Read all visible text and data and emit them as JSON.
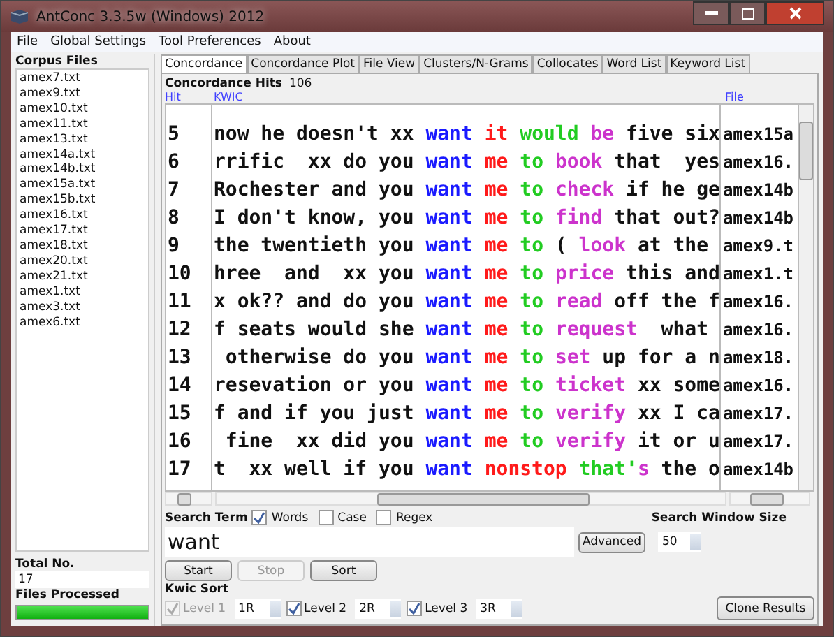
{
  "window": {
    "title": "AntConc 3.3.5w (Windows) 2012"
  },
  "menu": [
    "File",
    "Global Settings",
    "Tool Preferences",
    "About"
  ],
  "corpus": {
    "label": "Corpus Files",
    "files": [
      "amex7.txt",
      "amex9.txt",
      "amex10.txt",
      "amex11.txt",
      "amex13.txt",
      "amex14a.txt",
      "amex14b.txt",
      "amex15a.txt",
      "amex15b.txt",
      "amex16.txt",
      "amex17.txt",
      "amex18.txt",
      "amex20.txt",
      "amex21.txt",
      "amex1.txt",
      "amex3.txt",
      "amex6.txt"
    ],
    "total_label": "Total No.",
    "total": "17",
    "processed_label": "Files Processed",
    "level": 1
  },
  "tabs": [
    {
      "label": "Concordance",
      "selected": true
    },
    {
      "label": "Concordance Plot",
      "selected": false
    },
    {
      "label": "File View",
      "selected": false
    },
    {
      "label": "Clusters/N-Grams",
      "selected": false
    },
    {
      "label": "Collocates",
      "selected": false
    },
    {
      "label": "Word List",
      "selected": false
    },
    {
      "label": "Keyword List",
      "selected": false
    }
  ],
  "hits_label": "Concordance Hits",
  "hits": "106",
  "columns": [
    "Hit",
    "KWIC",
    "File"
  ],
  "rows": [
    {
      "hit": "5",
      "file": "amex15a",
      "segments": [
        {
          "text": "now he doesn't xx ",
          "kind": "plain"
        },
        {
          "text": "want ",
          "kind": "node"
        },
        {
          "text": "it ",
          "kind": "r1"
        },
        {
          "text": "would ",
          "kind": "r2"
        },
        {
          "text": "be",
          "kind": "r3"
        },
        {
          "text": " five six",
          "kind": "plain"
        }
      ]
    },
    {
      "hit": "6",
      "file": "amex16.",
      "segments": [
        {
          "text": "rrific  xx do you ",
          "kind": "plain"
        },
        {
          "text": "want ",
          "kind": "node"
        },
        {
          "text": "me ",
          "kind": "r1"
        },
        {
          "text": "to ",
          "kind": "r2"
        },
        {
          "text": "book",
          "kind": "r3"
        },
        {
          "text": " that  yes",
          "kind": "plain"
        }
      ]
    },
    {
      "hit": "7",
      "file": "amex14b",
      "segments": [
        {
          "text": "Rochester and you ",
          "kind": "plain"
        },
        {
          "text": "want ",
          "kind": "node"
        },
        {
          "text": "me ",
          "kind": "r1"
        },
        {
          "text": "to ",
          "kind": "r2"
        },
        {
          "text": "check",
          "kind": "r3"
        },
        {
          "text": " if he ge",
          "kind": "plain"
        }
      ]
    },
    {
      "hit": "8",
      "file": "amex14b",
      "segments": [
        {
          "text": "I don't know, you ",
          "kind": "plain"
        },
        {
          "text": "want ",
          "kind": "node"
        },
        {
          "text": "me ",
          "kind": "r1"
        },
        {
          "text": "to ",
          "kind": "r2"
        },
        {
          "text": "find",
          "kind": "r3"
        },
        {
          "text": " that out?",
          "kind": "plain"
        }
      ]
    },
    {
      "hit": "9",
      "file": "amex9.t",
      "segments": [
        {
          "text": "the twentieth you ",
          "kind": "plain"
        },
        {
          "text": "want ",
          "kind": "node"
        },
        {
          "text": "me ",
          "kind": "r1"
        },
        {
          "text": "to",
          "kind": "r2"
        },
        {
          "text": " ( ",
          "kind": "plain"
        },
        {
          "text": "look",
          "kind": "r3"
        },
        {
          "text": " at the",
          "kind": "plain"
        }
      ]
    },
    {
      "hit": "10",
      "file": "amex1.t",
      "segments": [
        {
          "text": "hree  and  xx you ",
          "kind": "plain"
        },
        {
          "text": "want ",
          "kind": "node"
        },
        {
          "text": "me ",
          "kind": "r1"
        },
        {
          "text": "to ",
          "kind": "r2"
        },
        {
          "text": "price",
          "kind": "r3"
        },
        {
          "text": " this and",
          "kind": "plain"
        }
      ]
    },
    {
      "hit": "11",
      "file": "amex16.",
      "segments": [
        {
          "text": "x ok?? and do you ",
          "kind": "plain"
        },
        {
          "text": "want ",
          "kind": "node"
        },
        {
          "text": "me ",
          "kind": "r1"
        },
        {
          "text": "to ",
          "kind": "r2"
        },
        {
          "text": "read",
          "kind": "r3"
        },
        {
          "text": " off the f",
          "kind": "plain"
        }
      ]
    },
    {
      "hit": "12",
      "file": "amex16.",
      "segments": [
        {
          "text": "f seats would she ",
          "kind": "plain"
        },
        {
          "text": "want ",
          "kind": "node"
        },
        {
          "text": "me ",
          "kind": "r1"
        },
        {
          "text": "to ",
          "kind": "r2"
        },
        {
          "text": "request",
          "kind": "r3"
        },
        {
          "text": "  what",
          "kind": "plain"
        }
      ]
    },
    {
      "hit": "13",
      "file": "amex18.",
      "segments": [
        {
          "text": " otherwise do you ",
          "kind": "plain"
        },
        {
          "text": "want ",
          "kind": "node"
        },
        {
          "text": "me ",
          "kind": "r1"
        },
        {
          "text": "to ",
          "kind": "r2"
        },
        {
          "text": "set",
          "kind": "r3"
        },
        {
          "text": " up for a n",
          "kind": "plain"
        }
      ]
    },
    {
      "hit": "14",
      "file": "amex16.",
      "segments": [
        {
          "text": "resevation or you ",
          "kind": "plain"
        },
        {
          "text": "want ",
          "kind": "node"
        },
        {
          "text": "me ",
          "kind": "r1"
        },
        {
          "text": "to ",
          "kind": "r2"
        },
        {
          "text": "ticket",
          "kind": "r3"
        },
        {
          "text": " xx some",
          "kind": "plain"
        }
      ]
    },
    {
      "hit": "15",
      "file": "amex17.",
      "segments": [
        {
          "text": "f and if you just ",
          "kind": "plain"
        },
        {
          "text": "want ",
          "kind": "node"
        },
        {
          "text": "me ",
          "kind": "r1"
        },
        {
          "text": "to ",
          "kind": "r2"
        },
        {
          "text": "verify",
          "kind": "r3"
        },
        {
          "text": " xx I ca",
          "kind": "plain"
        }
      ]
    },
    {
      "hit": "16",
      "file": "amex17.",
      "segments": [
        {
          "text": " fine  xx did you ",
          "kind": "plain"
        },
        {
          "text": "want ",
          "kind": "node"
        },
        {
          "text": "me ",
          "kind": "r1"
        },
        {
          "text": "to ",
          "kind": "r2"
        },
        {
          "text": "verify",
          "kind": "r3"
        },
        {
          "text": " it or u",
          "kind": "plain"
        }
      ]
    },
    {
      "hit": "17",
      "file": "amex14b",
      "segments": [
        {
          "text": "t  xx well if you ",
          "kind": "plain"
        },
        {
          "text": "want ",
          "kind": "node"
        },
        {
          "text": "nonstop ",
          "kind": "r1"
        },
        {
          "text": "that'",
          "kind": "r2"
        },
        {
          "text": "s",
          "kind": "r3"
        },
        {
          "text": " the o",
          "kind": "plain"
        }
      ]
    }
  ],
  "search": {
    "label": "Search Term",
    "options": [
      {
        "label": "Words",
        "checked": true
      },
      {
        "label": "Case",
        "checked": false
      },
      {
        "label": "Regex",
        "checked": false
      }
    ],
    "value": "want",
    "advanced": "Advanced",
    "window_label": "Search Window Size",
    "window_size": "50"
  },
  "buttons": [
    {
      "label": "Start",
      "disabled": false
    },
    {
      "label": "Stop",
      "disabled": true
    },
    {
      "label": "Sort",
      "disabled": false
    }
  ],
  "kwic_sort": {
    "label": "Kwic Sort",
    "levels": [
      {
        "label": "Level 1",
        "checked": true,
        "disabled": true,
        "value": "1R"
      },
      {
        "label": "Level 2",
        "checked": true,
        "disabled": false,
        "value": "2R"
      },
      {
        "label": "Level 3",
        "checked": true,
        "disabled": false,
        "value": "3R"
      }
    ]
  },
  "clone": "Clone Results"
}
